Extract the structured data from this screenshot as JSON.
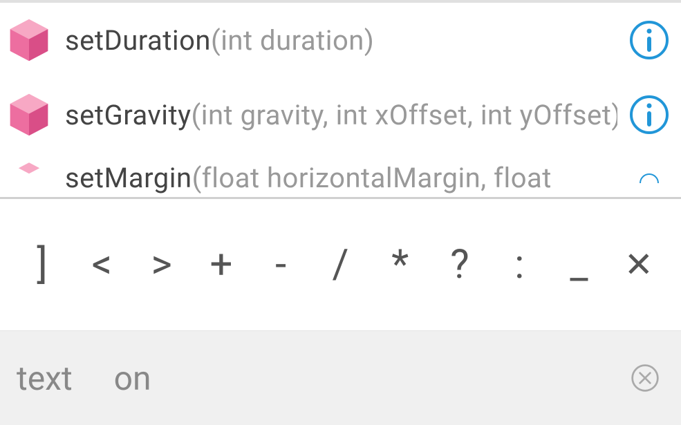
{
  "suggestions": [
    {
      "name": "setDuration",
      "params": "(int duration)"
    },
    {
      "name": "setGravity",
      "params": "(int gravity, int xOffset, int yOffset)"
    },
    {
      "name": "setMargin",
      "params": "(float horizontalMargin, float"
    }
  ],
  "symbol_keys": [
    "]",
    "<",
    ">",
    "+",
    "-",
    "/",
    "*",
    "?",
    ":",
    "_",
    "✕"
  ],
  "word_suggestions": [
    "text",
    "on"
  ],
  "colors": {
    "cube_light": "#f7a8c4",
    "cube_mid": "#ed6ea0",
    "cube_dark": "#d94e87",
    "info_stroke": "#2196d8",
    "method_name": "#444444",
    "method_params": "#999999",
    "symbol_text": "#555555",
    "word_text": "#888888",
    "word_bar_bg": "#f0f0f0",
    "clear_stroke": "#aaaaaa"
  }
}
